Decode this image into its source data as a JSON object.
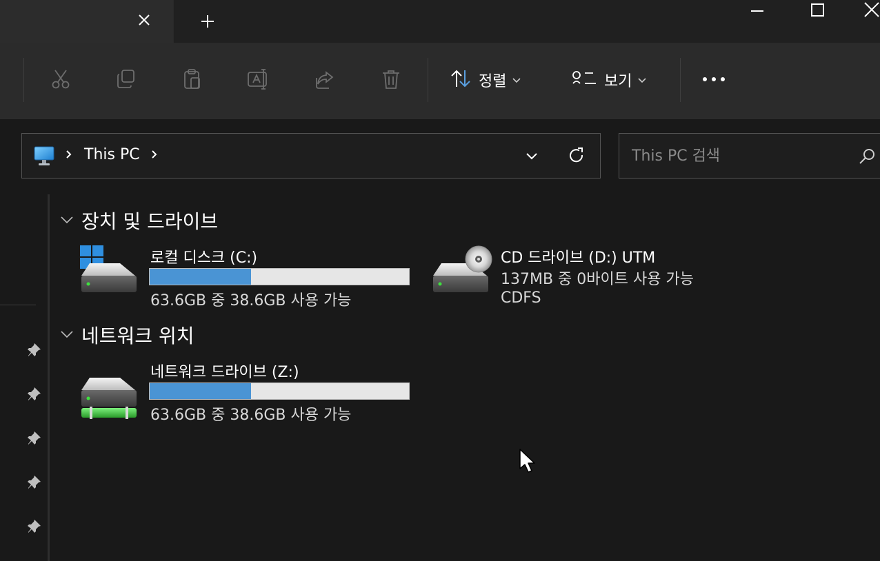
{
  "tabs": {
    "close_icon": "close-icon",
    "new_tab_icon": "plus-icon"
  },
  "toolbar": {
    "sort_label": "정렬",
    "view_label": "보기"
  },
  "address": {
    "location": "This PC"
  },
  "search": {
    "placeholder": "This PC 검색"
  },
  "groups": {
    "devices": {
      "title": "장치 및 드라이브",
      "drives": [
        {
          "name": "로컬 디스크 (C:)",
          "usage_text": "63.6GB 중 38.6GB 사용 가능",
          "used_fraction": 0.39
        },
        {
          "name": "CD 드라이브 (D:) UTM",
          "usage_text": "137MB 중 0바이트 사용 가능",
          "filesystem": "CDFS"
        }
      ]
    },
    "network": {
      "title": "네트워크 위치",
      "drives": [
        {
          "name": "네트워크 드라이브 (Z:)",
          "usage_text": "63.6GB 중 38.6GB 사용 가능",
          "used_fraction": 0.39
        }
      ]
    }
  },
  "colors": {
    "background": "#191919",
    "toolbar": "#2b2b2b",
    "bar_fill": "#4a94d4",
    "bar_track": "#e6e6e6"
  }
}
